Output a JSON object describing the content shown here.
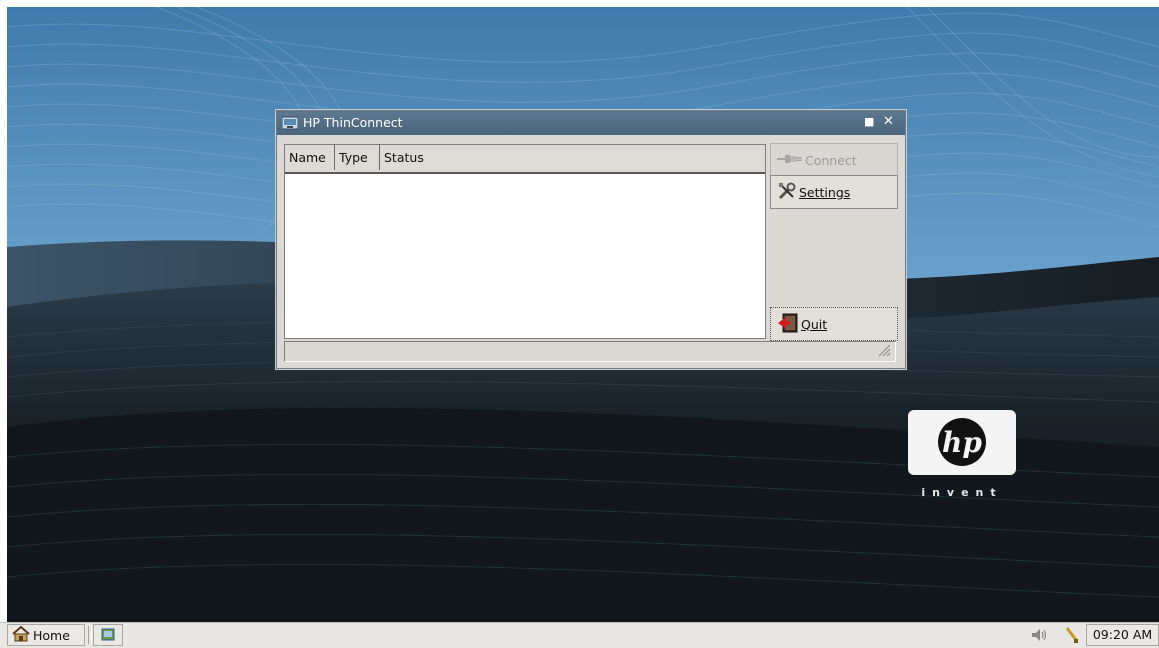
{
  "window": {
    "title": "HP ThinConnect",
    "columns": [
      "Name",
      "Type",
      "Status"
    ],
    "buttons": {
      "connect": "Connect",
      "settings": "Settings",
      "quit": "Quit"
    }
  },
  "desktop": {
    "logo_word": "invent",
    "logo_icon": "hp-logo"
  },
  "taskbar": {
    "home": "Home",
    "clock": "09:20 AM"
  },
  "colors": {
    "titlebar": "#4f6a81",
    "desktop_sky": "#5c95c2",
    "desktop_dark": "#131a20"
  }
}
